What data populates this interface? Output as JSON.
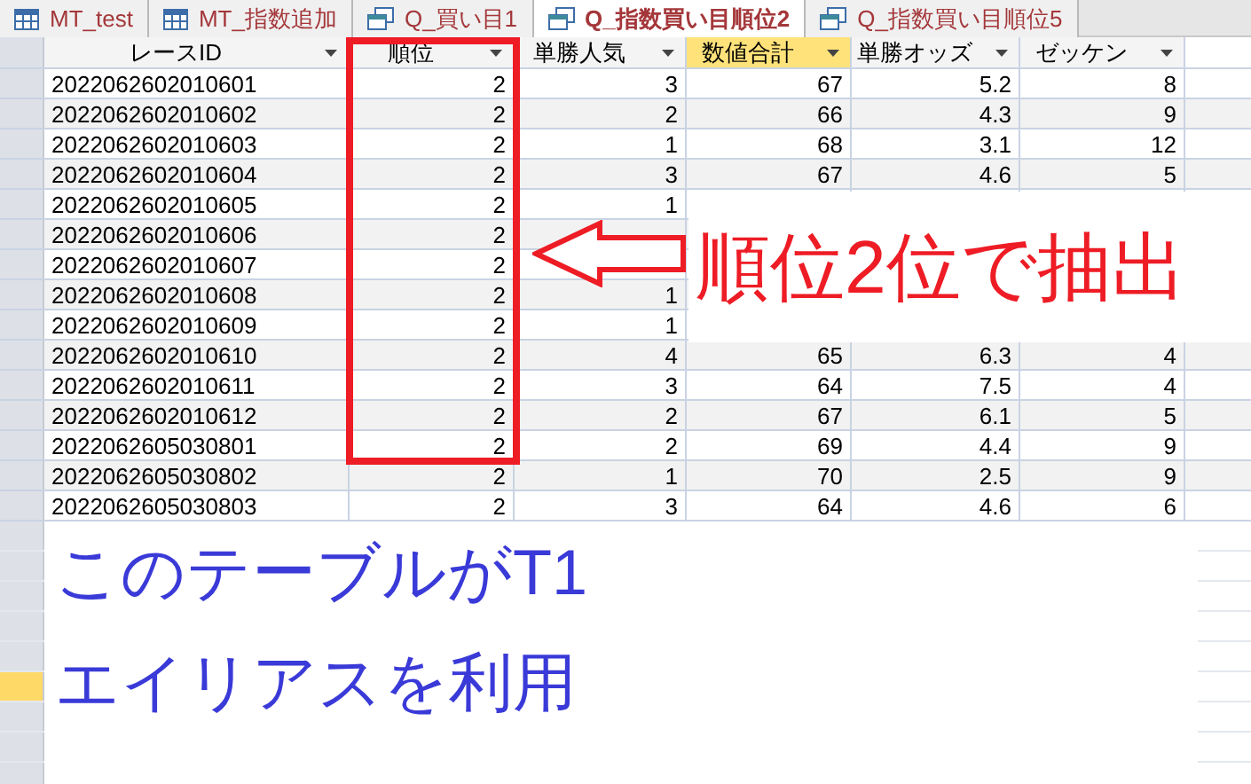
{
  "tabs": [
    {
      "label": "MT_test",
      "kind": "table",
      "selected": false
    },
    {
      "label": "MT_指数追加",
      "kind": "table",
      "selected": false
    },
    {
      "label": "Q_買い目1",
      "kind": "query",
      "selected": false
    },
    {
      "label": "Q_指数買い目順位2",
      "kind": "query",
      "selected": true
    },
    {
      "label": "Q_指数買い目順位5",
      "kind": "query",
      "selected": false
    }
  ],
  "columns": [
    {
      "label": "レースID",
      "highlighted": false
    },
    {
      "label": "順位",
      "highlighted": false
    },
    {
      "label": "単勝人気",
      "highlighted": false
    },
    {
      "label": "数値合計",
      "highlighted": true
    },
    {
      "label": "単勝オッズ",
      "highlighted": false
    },
    {
      "label": "ゼッケン",
      "highlighted": false
    }
  ],
  "rows": [
    [
      "2022062602010601",
      "2",
      "3",
      "67",
      "5.2",
      "8"
    ],
    [
      "2022062602010602",
      "2",
      "2",
      "66",
      "4.3",
      "9"
    ],
    [
      "2022062602010603",
      "2",
      "1",
      "68",
      "3.1",
      "12"
    ],
    [
      "2022062602010604",
      "2",
      "3",
      "67",
      "4.6",
      "5"
    ],
    [
      "2022062602010605",
      "2",
      "1",
      null,
      null,
      null
    ],
    [
      "2022062602010606",
      "2",
      null,
      null,
      null,
      null
    ],
    [
      "2022062602010607",
      "2",
      null,
      null,
      null,
      null
    ],
    [
      "2022062602010608",
      "2",
      "1",
      null,
      null,
      null
    ],
    [
      "2022062602010609",
      "2",
      "1",
      null,
      null,
      null
    ],
    [
      "2022062602010610",
      "2",
      "4",
      "65",
      "6.3",
      "4"
    ],
    [
      "2022062602010611",
      "2",
      "3",
      "64",
      "7.5",
      "4"
    ],
    [
      "2022062602010612",
      "2",
      "2",
      "67",
      "6.1",
      "5"
    ],
    [
      "2022062605030801",
      "2",
      "2",
      "69",
      "4.4",
      "9"
    ],
    [
      "2022062605030802",
      "2",
      "1",
      "70",
      "2.5",
      "9"
    ],
    [
      "2022062605030803",
      "2",
      "3",
      "64",
      "4.6",
      "6"
    ]
  ],
  "covered_rows": [
    {
      "selected": false
    },
    {
      "selected": false
    },
    {
      "selected": false
    },
    {
      "selected": false
    },
    {
      "selected": false
    },
    {
      "selected": true
    },
    {
      "selected": false
    },
    {
      "selected": false
    },
    {
      "selected": false
    }
  ],
  "callout": {
    "text": "順位2位で抽出"
  },
  "note": {
    "lines": [
      "このテーブルがT1",
      "エイリアスを利用"
    ]
  }
}
